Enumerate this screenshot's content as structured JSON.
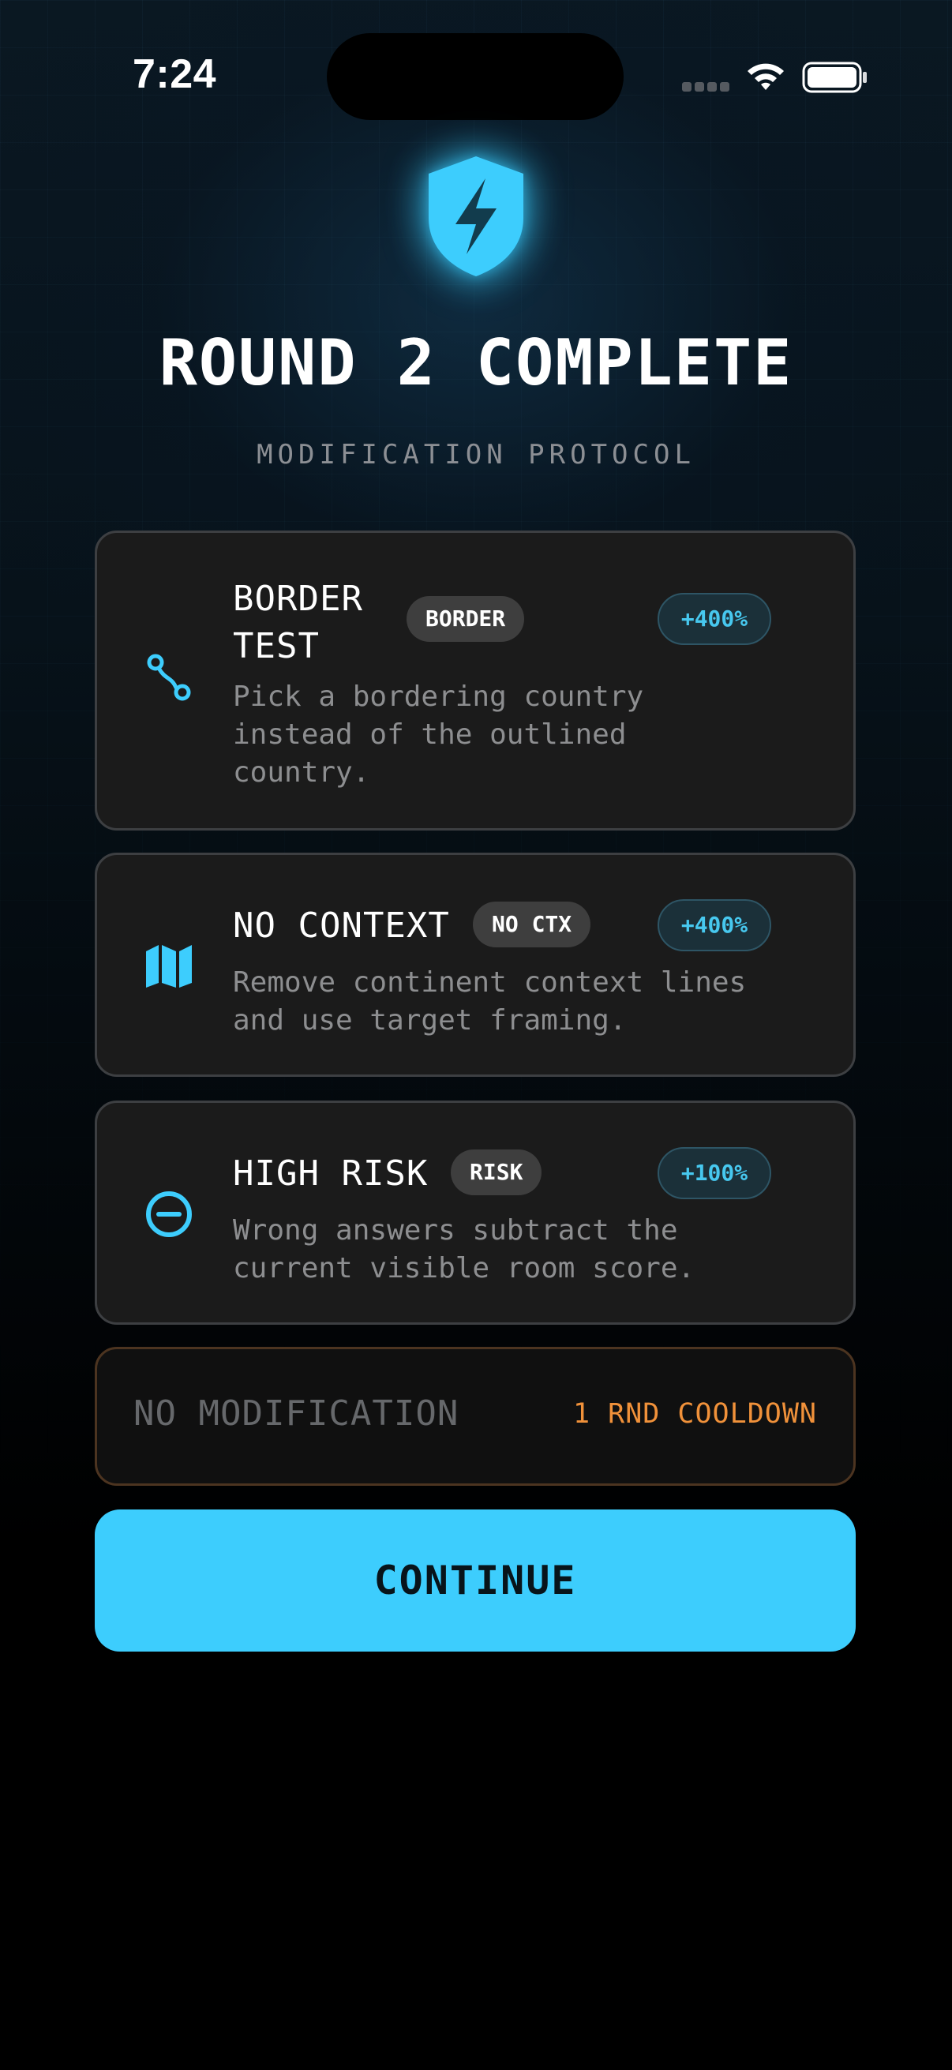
{
  "status_bar": {
    "time": "7:24"
  },
  "header": {
    "logo_icon": "shield-bolt-icon",
    "title": "ROUND 2 COMPLETE",
    "subtitle": "MODIFICATION PROTOCOL"
  },
  "colors": {
    "accent": "#3DCDFD",
    "card_bg": "#1B1B1B",
    "card_border": "#3D3F42",
    "cooldown": "#F0913A",
    "tag_bg": "#3E3E3E",
    "bonus_bg": "#1B3039",
    "bonus_text": "#47C8EF"
  },
  "modifications": [
    {
      "icon": "route-icon",
      "title_line1": "BORDER",
      "title_line2": "TEST",
      "tag": "BORDER",
      "bonus": "+400%",
      "description_line1": "Pick a bordering country",
      "description_line2": "instead of the outlined",
      "description_line3": "country."
    },
    {
      "icon": "map-icon",
      "title": "NO CONTEXT",
      "tag": "NO CTX",
      "bonus": "+400%",
      "description_line1": "Remove continent context lines",
      "description_line2": "and use target framing."
    },
    {
      "icon": "minus-circle-icon",
      "title": "HIGH RISK",
      "tag": "RISK",
      "bonus": "+100%",
      "description_line1": "Wrong answers subtract the",
      "description_line2": "current visible room score."
    }
  ],
  "no_modification": {
    "label": "NO MODIFICATION",
    "cooldown": "1 RND COOLDOWN"
  },
  "continue_label": "CONTINUE"
}
